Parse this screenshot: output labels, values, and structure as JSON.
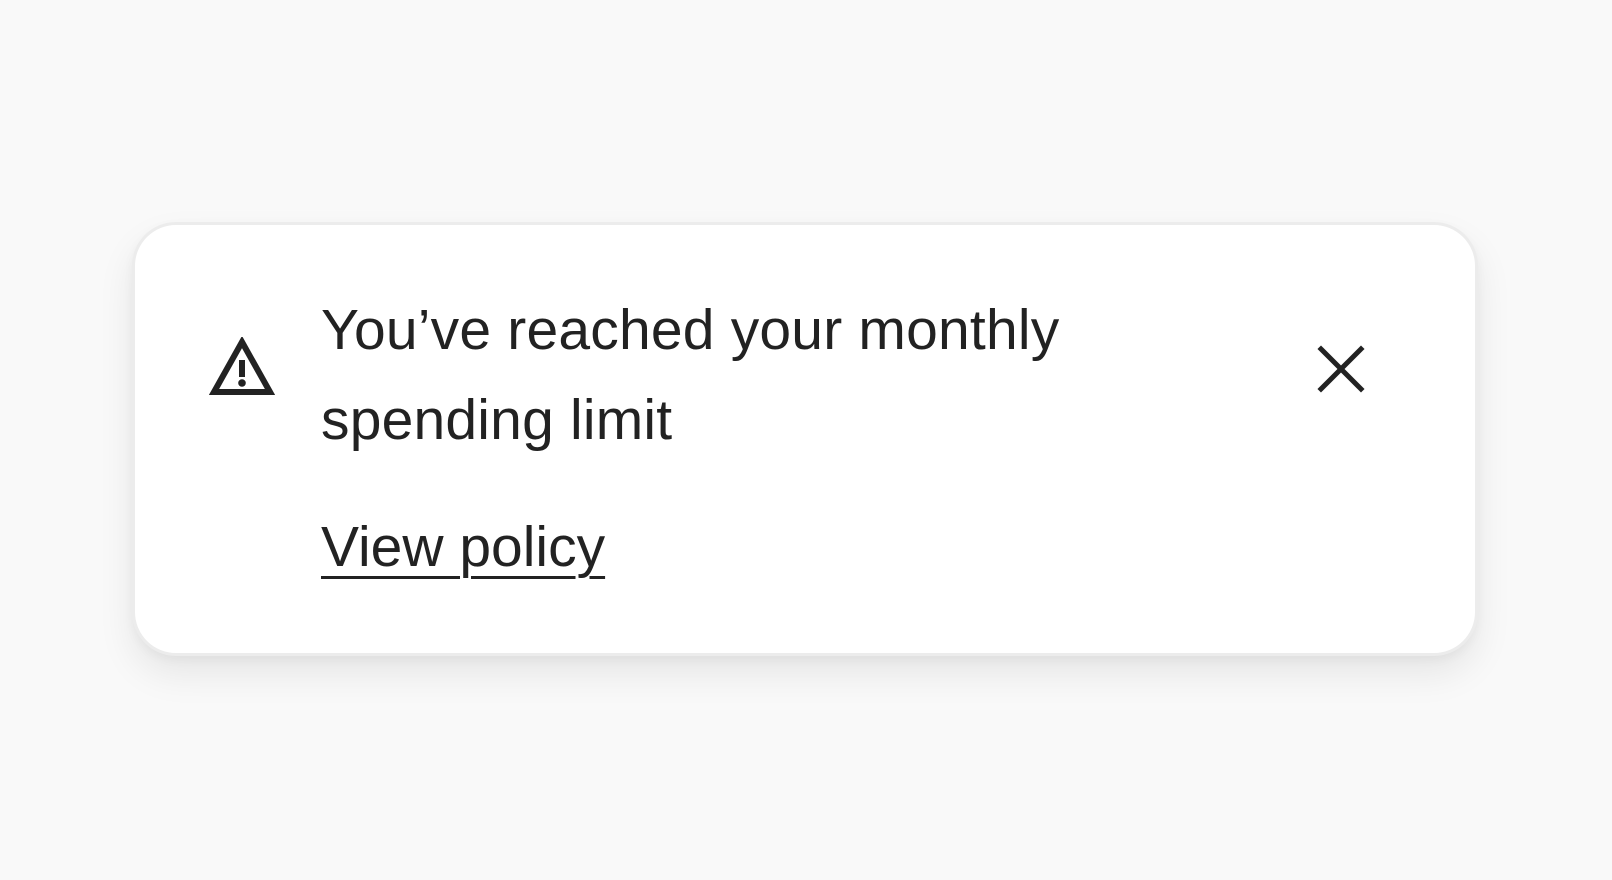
{
  "notification": {
    "icon": "warning-triangle-icon",
    "message": "You’ve reached your monthly spending limit",
    "link_label": "View policy",
    "dismiss_icon": "close-icon"
  },
  "colors": {
    "page_background": "#f9f9f9",
    "card_background": "#ffffff",
    "card_border": "#ececec",
    "text": "#222222"
  }
}
